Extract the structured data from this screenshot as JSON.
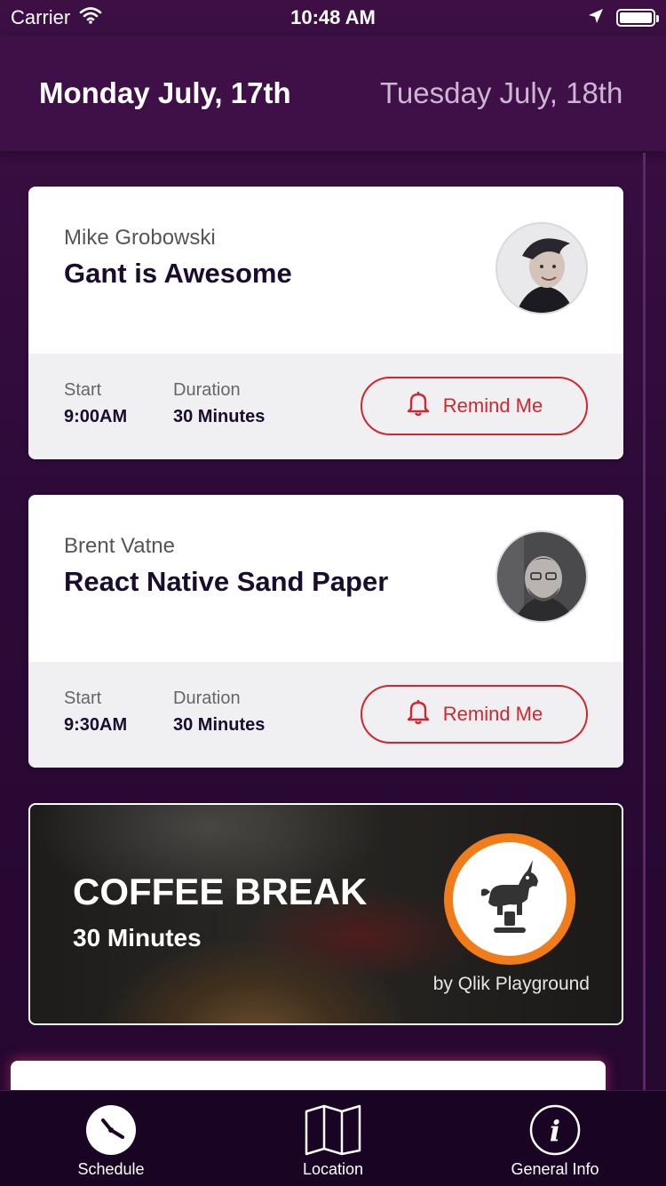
{
  "status_bar": {
    "carrier": "Carrier",
    "time": "10:48 AM"
  },
  "header": {
    "days": [
      {
        "label": "Monday July, 17th",
        "active": true
      },
      {
        "label": "Tuesday July, 18th",
        "active": false
      }
    ]
  },
  "sessions": [
    {
      "speaker": "Mike Grobowski",
      "title": "Gant is Awesome",
      "start_label": "Start",
      "start": "9:00AM",
      "duration_label": "Duration",
      "duration": "30 Minutes",
      "remind_label": "Remind Me"
    },
    {
      "speaker": "Brent Vatne",
      "title": "React Native Sand Paper",
      "start_label": "Start",
      "start": "9:30AM",
      "duration_label": "Duration",
      "duration": "30 Minutes",
      "remind_label": "Remind Me"
    }
  ],
  "coffee_break": {
    "title": "COFFEE BREAK",
    "duration": "30 Minutes",
    "sponsor": "by Qlik Playground"
  },
  "tabs": [
    {
      "label": "Schedule",
      "icon": "clock-icon",
      "active": true
    },
    {
      "label": "Location",
      "icon": "map-icon",
      "active": false
    },
    {
      "label": "General Info",
      "icon": "info-icon",
      "active": false
    }
  ],
  "colors": {
    "accent": "#d0262f",
    "background": "#2c0a38",
    "orange": "#f07d1a"
  }
}
